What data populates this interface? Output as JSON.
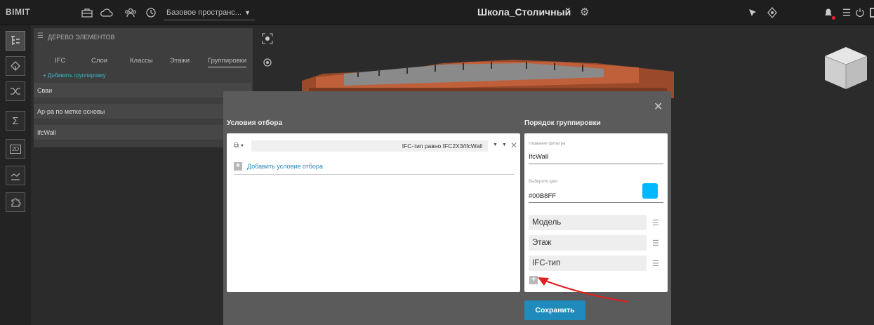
{
  "topbar": {
    "logo": "BIMIT",
    "space_select": "Базовое пространс...",
    "project_title": "Школа_Столичный"
  },
  "tree_panel": {
    "header": "ДЕРЕВО ЭЛЕМЕНТОВ",
    "tabs": [
      "IFC",
      "Слои",
      "Классы",
      "Этажи",
      "Группировки"
    ],
    "selected_tab": "Группировки",
    "add_grouping": "+ Добавить группировку",
    "rows": [
      "Сваи",
      "Ар-ра по метке основы",
      "IfcWall"
    ]
  },
  "dialog": {
    "conditions_title": "Условия отбора",
    "condition_value": "IFC-тип равно IFC2X3/IfcWall",
    "add_condition": "Добавить условие отбора",
    "grouping_title": "Порядок группировки",
    "filter_name_label": "Название фильтра",
    "filter_name_value": "IfcWall",
    "color_label": "Выберите цвет",
    "color_value": "#00B8FF",
    "group_items": [
      "Модель",
      "Этаж",
      "IFC-тип"
    ],
    "save_label": "Сохранить"
  },
  "colors": {
    "accent": "#1f8bbd",
    "selected_color": "#00B8FF",
    "arrow": "#e02020"
  }
}
